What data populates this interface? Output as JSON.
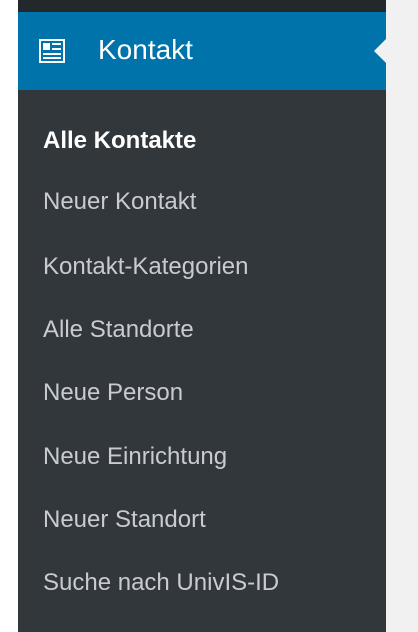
{
  "menu": {
    "title": "Kontakt",
    "icon": "contact-card-icon",
    "accent_color": "#0073aa",
    "items": [
      {
        "label": "Alle Kontakte",
        "current": true
      },
      {
        "label": "Neuer Kontakt",
        "current": false
      },
      {
        "label": "Kontakt-Kategorien",
        "current": false
      },
      {
        "label": "Alle Standorte",
        "current": false
      },
      {
        "label": "Neue Person",
        "current": false
      },
      {
        "label": "Neue Einrichtung",
        "current": false
      },
      {
        "label": "Neuer Standort",
        "current": false
      },
      {
        "label": "Suche nach UnivIS-ID",
        "current": false
      }
    ]
  }
}
